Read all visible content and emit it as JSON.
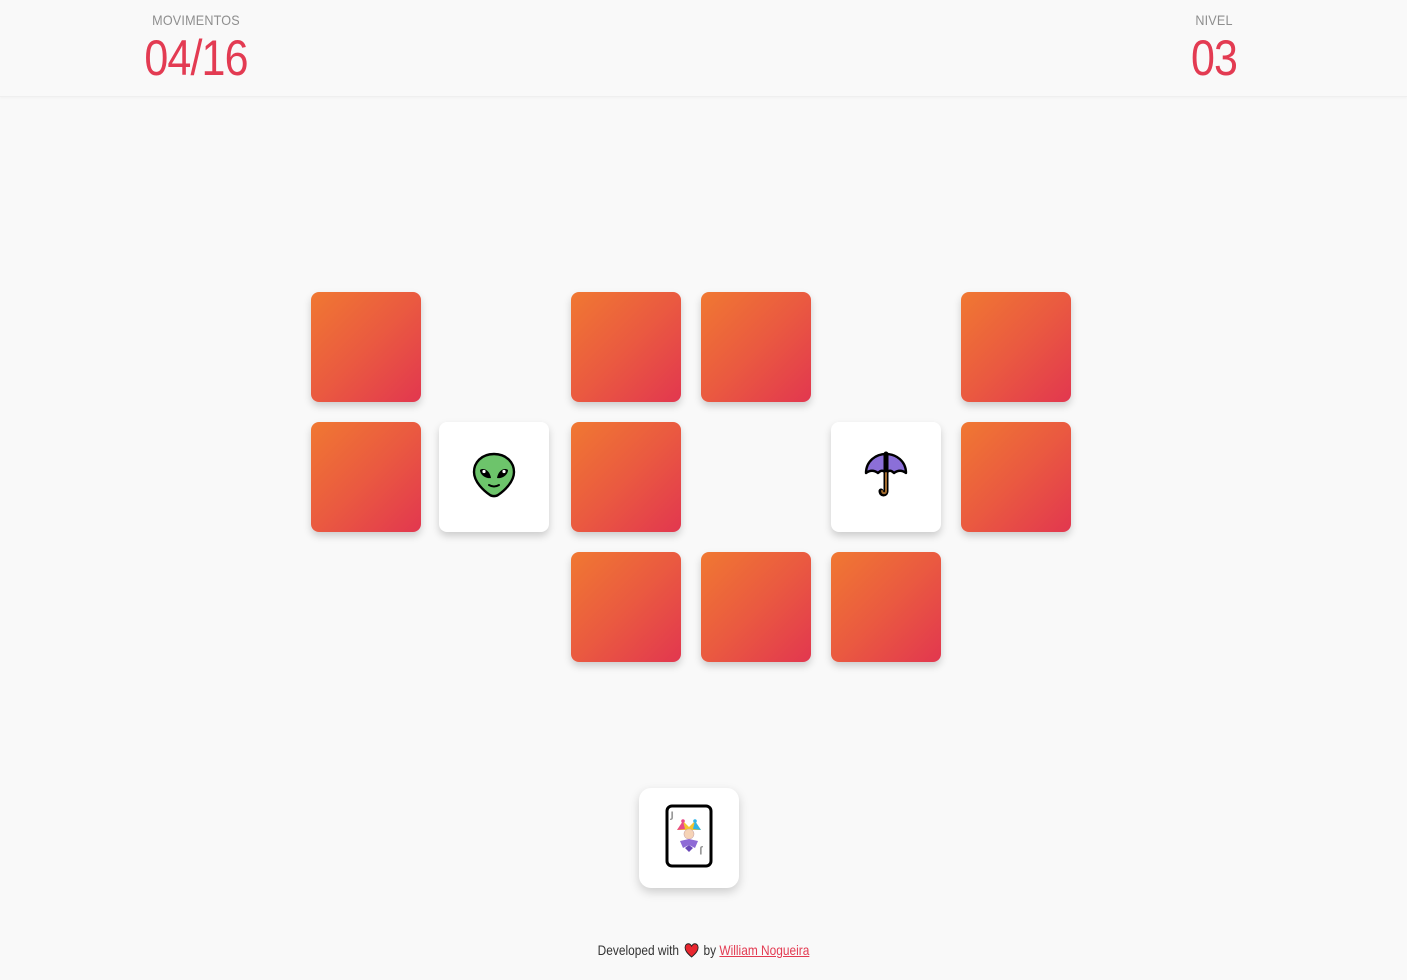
{
  "header": {
    "moves_label": "MOVIMENTOS",
    "moves_value": "04/16",
    "level_label": "NIVEL",
    "level_value": "03"
  },
  "board": {
    "cards": [
      {
        "state": "face-down"
      },
      {
        "state": "matched"
      },
      {
        "state": "face-down"
      },
      {
        "state": "face-down"
      },
      {
        "state": "matched"
      },
      {
        "state": "face-down"
      },
      {
        "state": "face-down"
      },
      {
        "state": "face-up",
        "icon": "alien-icon"
      },
      {
        "state": "face-down"
      },
      {
        "state": "matched"
      },
      {
        "state": "face-up",
        "icon": "umbrella-icon"
      },
      {
        "state": "face-down"
      },
      {
        "state": "matched"
      },
      {
        "state": "matched"
      },
      {
        "state": "face-down"
      },
      {
        "state": "face-down"
      },
      {
        "state": "face-down"
      },
      {
        "state": "matched"
      }
    ]
  },
  "joker": {
    "icon": "joker-card-icon"
  },
  "footer": {
    "developed_with": "Developed with",
    "by": "by",
    "author": "William Nogueira"
  },
  "colors": {
    "accent": "#e33b52",
    "card_gradient_start": "#f07832",
    "card_gradient_end": "#e2374f",
    "background": "#f9f9f9"
  }
}
